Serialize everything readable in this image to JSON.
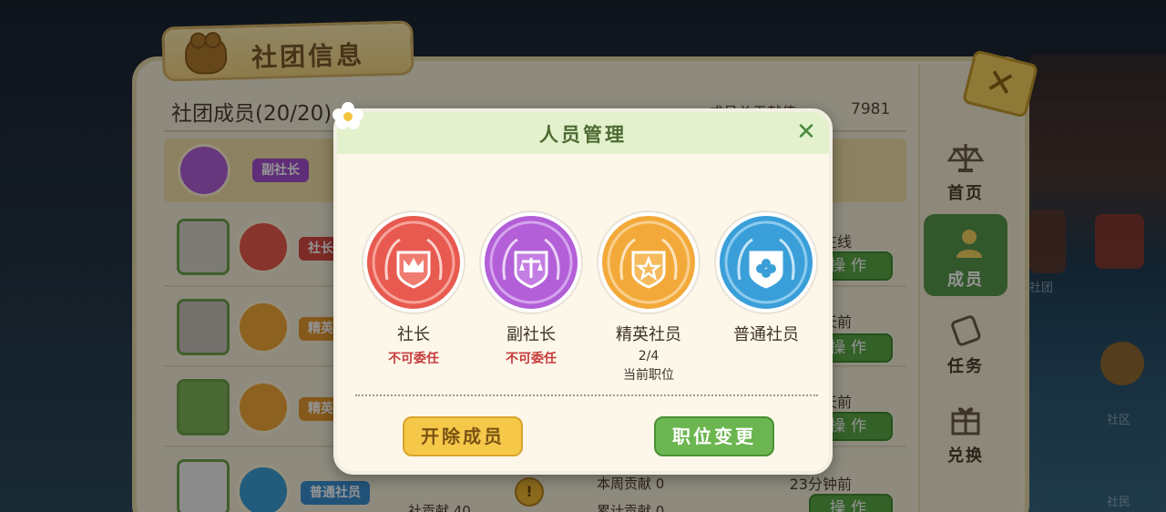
{
  "panel": {
    "title": "社团信息",
    "members_header": "社团成员(20/20)",
    "header_right_label": "成员总贡献值",
    "header_right_value": "7981"
  },
  "rows": [
    {
      "role_tag": "副社长",
      "status": "",
      "op": ""
    },
    {
      "role_tag": "社长",
      "status": "在线",
      "op": "操作"
    },
    {
      "role_tag": "精英",
      "status": "1天前",
      "op": "操作"
    },
    {
      "role_tag": "精英",
      "status": "1天前",
      "op": "操作"
    },
    {
      "role_tag": "普通社员",
      "status": "23分钟前",
      "op": "操作",
      "extra_left": "社贡献 40",
      "extra_mid_1": "本周贡献 0",
      "extra_mid_2": "累计贡献 0"
    }
  ],
  "sidebar": {
    "items": [
      {
        "label": "首页",
        "icon": "scales-icon"
      },
      {
        "label": "成员",
        "icon": "member-icon"
      },
      {
        "label": "任务",
        "icon": "scroll-icon"
      },
      {
        "label": "兑换",
        "icon": "gift-icon"
      }
    ]
  },
  "scene": {
    "label_1": "社团",
    "label_2": "社区",
    "label_3": "社民"
  },
  "modal": {
    "title": "人员管理",
    "close_icon": "close-icon",
    "roles": [
      {
        "name": "社长",
        "sub": "不可委任",
        "color": "#e85a4f",
        "icon": "crown-icon"
      },
      {
        "name": "副社长",
        "sub": "不可委任",
        "color": "#b25fd8",
        "icon": "scales-icon"
      },
      {
        "name": "精英社员",
        "sub": "2/4",
        "current": "当前职位",
        "color": "#f3a93a",
        "icon": "star-icon"
      },
      {
        "name": "普通社员",
        "sub": "",
        "color": "#3a9fd8",
        "icon": "clover-icon"
      }
    ],
    "buttons": {
      "kick": "开除成员",
      "change": "职位变更"
    }
  },
  "colors": {
    "accent_green": "#6bb650",
    "accent_yellow": "#f6c84a",
    "warning_red": "#c73b3b"
  }
}
